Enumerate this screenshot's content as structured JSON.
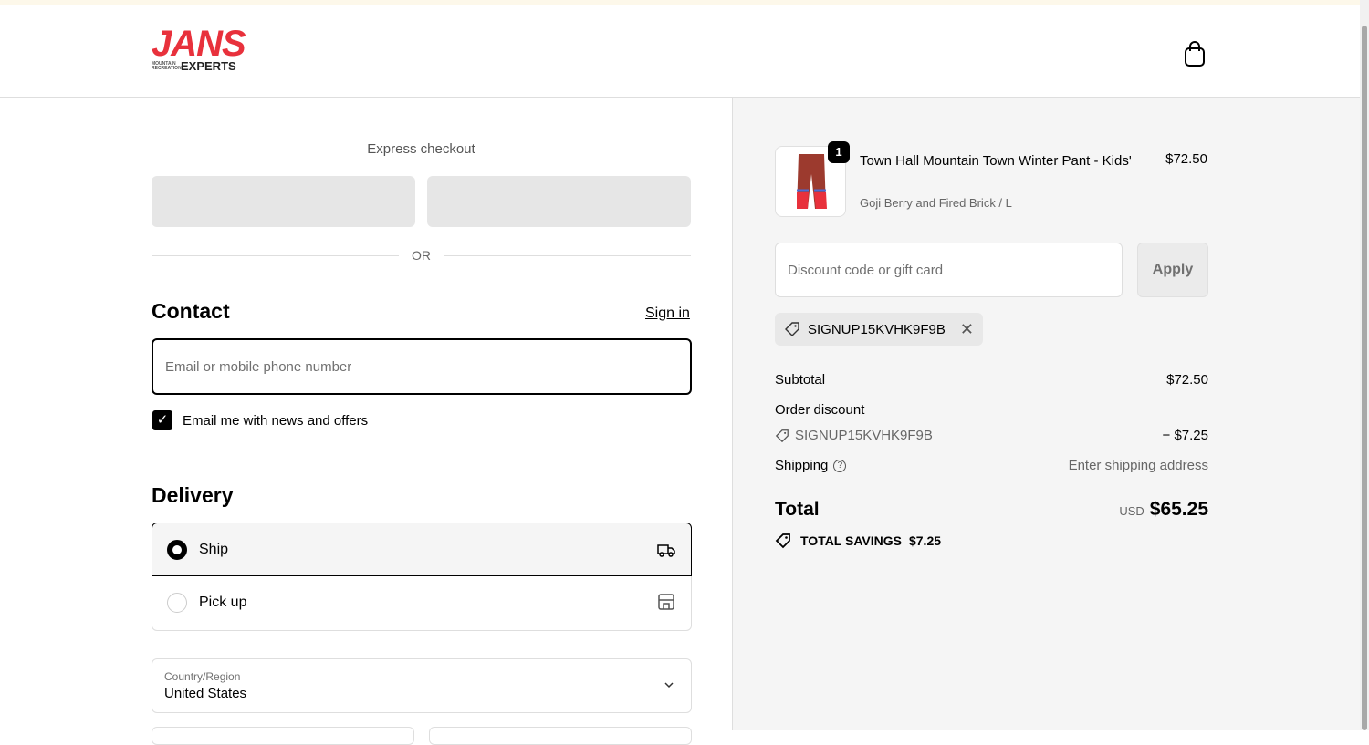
{
  "header": {
    "logo_main": "JANS",
    "logo_small": "MOUNTAIN RECREATION",
    "logo_sub": "EXPERTS",
    "cart_icon": "shopping-bag-icon"
  },
  "express": {
    "title": "Express checkout",
    "or": "OR"
  },
  "contact": {
    "title": "Contact",
    "sign_in": "Sign in",
    "email_placeholder": "Email or mobile phone number",
    "news_label": "Email me with news and offers",
    "news_checked": true
  },
  "delivery": {
    "title": "Delivery",
    "options": [
      {
        "label": "Ship",
        "selected": true,
        "icon": "truck-icon"
      },
      {
        "label": "Pick up",
        "selected": false,
        "icon": "store-icon"
      }
    ]
  },
  "country": {
    "label": "Country/Region",
    "value": "United States"
  },
  "summary": {
    "item": {
      "qty": "1",
      "name": "Town Hall Mountain Town Winter Pant - Kids'",
      "variant": "Goji Berry and Fired Brick / L",
      "price": "$72.50"
    },
    "discount_placeholder": "Discount code or gift card",
    "apply": "Apply",
    "applied_code": "SIGNUP15KVHK9F9B",
    "subtotal_label": "Subtotal",
    "subtotal": "$72.50",
    "order_discount_label": "Order discount",
    "discount_code": "SIGNUP15KVHK9F9B",
    "discount_amount": "− $7.25",
    "shipping_label": "Shipping",
    "shipping_value": "Enter shipping address",
    "total_label": "Total",
    "currency": "USD",
    "total": "$65.25",
    "savings_label": "TOTAL SAVINGS",
    "savings": "$7.25"
  }
}
